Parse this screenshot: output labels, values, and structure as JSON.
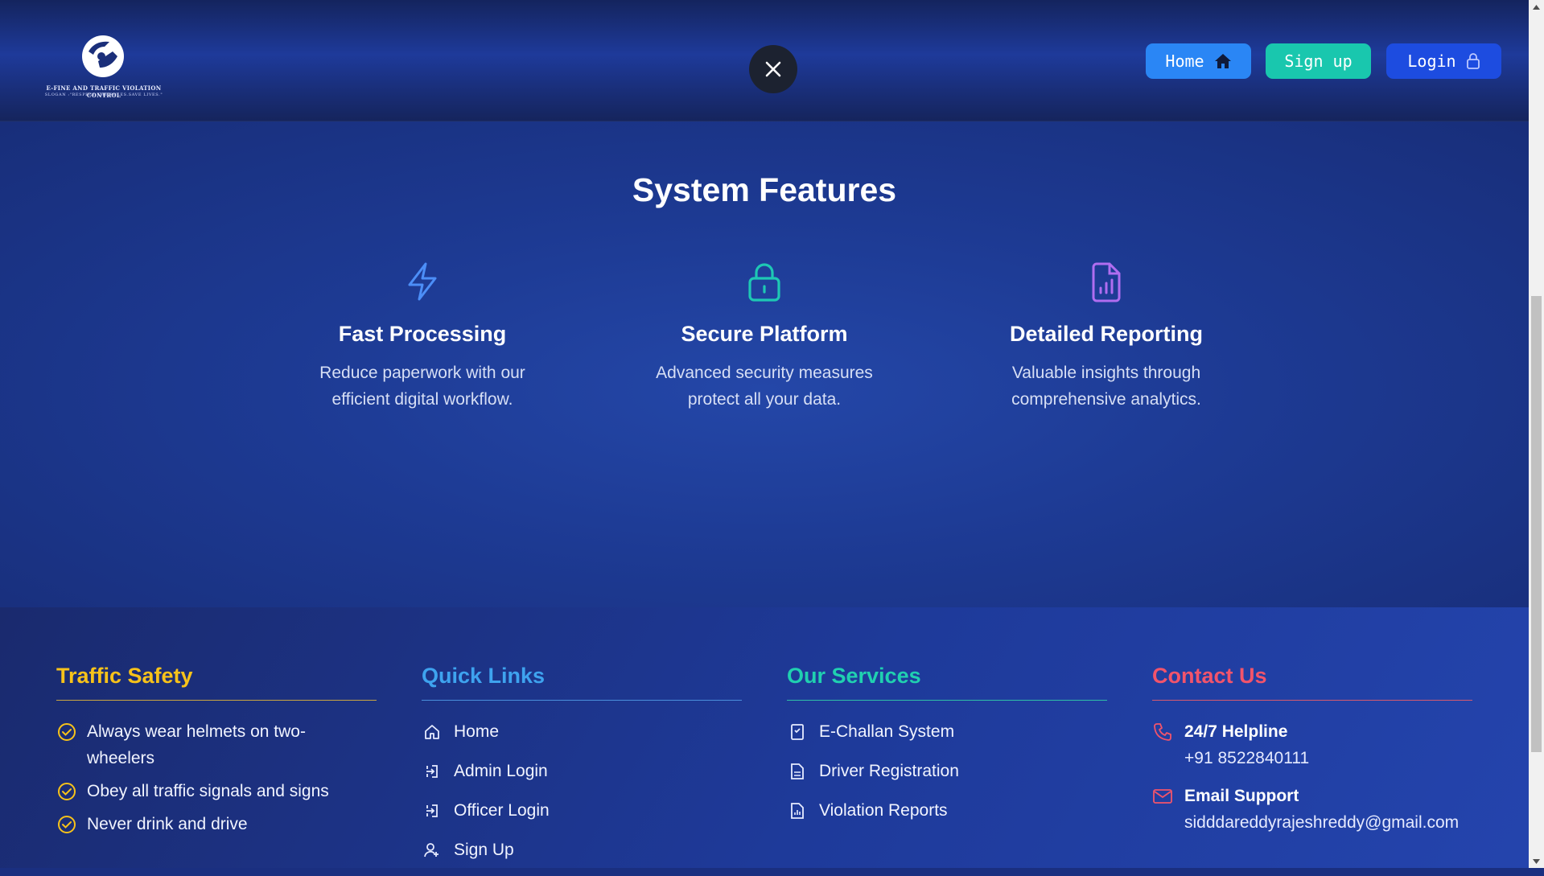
{
  "header": {
    "logo_title": "E-FINE AND TRAFFIC VIOLATION CONTROL",
    "logo_slogan": "SLOGAN :\"RESPECT THE RULES.SAVE LIVES.\"",
    "close_icon": "close-icon",
    "nav": {
      "home_label": "Home",
      "signup_label": "Sign up",
      "login_label": "Login"
    }
  },
  "features": {
    "title": "System Features",
    "items": [
      {
        "icon": "lightning-icon",
        "color": "#4c8ef7",
        "title": "Fast Processing",
        "desc_line1": "Reduce paperwork with our",
        "desc_line2": "efficient digital workflow."
      },
      {
        "icon": "lock-icon",
        "color": "#1ec8b4",
        "title": "Secure Platform",
        "desc_line1": "Advanced security measures",
        "desc_line2": "protect all your data."
      },
      {
        "icon": "report-file-icon",
        "color": "#b06df0",
        "title": "Detailed Reporting",
        "desc_line1": "Valuable insights through",
        "desc_line2": "comprehensive analytics."
      }
    ]
  },
  "footer": {
    "traffic_safety": {
      "title": "Traffic Safety",
      "items": [
        {
          "line1": "Always wear helmets on two-",
          "line2": "wheelers"
        },
        {
          "line1": "Obey all traffic signals and signs"
        },
        {
          "line1": "Never drink and drive"
        }
      ]
    },
    "quick_links": {
      "title": "Quick Links",
      "items": [
        "Home",
        "Admin Login",
        "Officer Login",
        "Sign Up"
      ]
    },
    "services": {
      "title": "Our Services",
      "items": [
        "E-Challan System",
        "Driver Registration",
        "Violation Reports"
      ]
    },
    "contact": {
      "title": "Contact Us",
      "helpline_label": "24/7 Helpline",
      "helpline_value": "+91 8522840111",
      "email_label": "Email Support",
      "email_value": "sidddareddyrajeshreddy@gmail.com"
    }
  },
  "colors": {
    "accent_yellow": "#f7c21a",
    "accent_blue": "#3ea3ef",
    "accent_teal": "#20d0b0",
    "accent_red": "#f2546b"
  }
}
